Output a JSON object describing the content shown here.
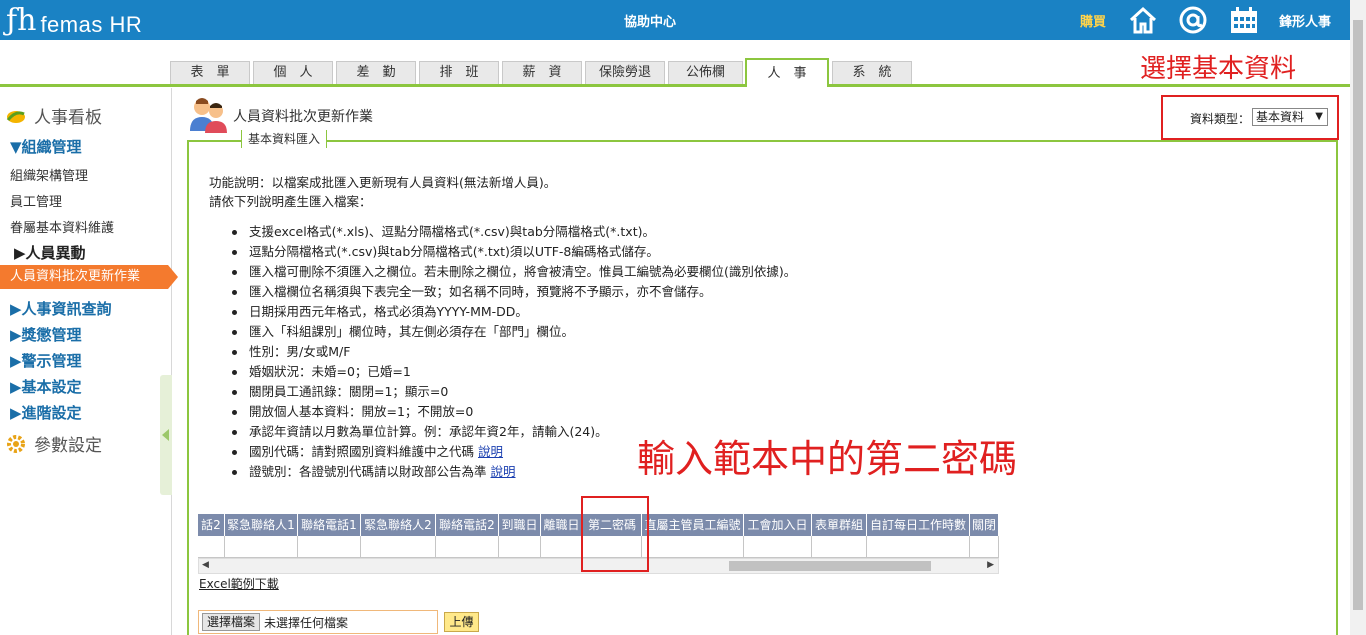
{
  "header": {
    "logo_text": "femas HR",
    "center_title": "協助中心",
    "buy_label": "購買",
    "home_icon": "home-icon",
    "at_icon": "at-icon",
    "calendar_icon": "calendar-icon",
    "user_name": "鋒形人事"
  },
  "tabs": [
    {
      "label": "表　單"
    },
    {
      "label": "個　人"
    },
    {
      "label": "差　勤"
    },
    {
      "label": "排　班"
    },
    {
      "label": "薪　資"
    },
    {
      "label": "保險勞退"
    },
    {
      "label": "公佈欄"
    },
    {
      "label": "人　事",
      "active": true
    },
    {
      "label": "系　統"
    }
  ],
  "annotations": {
    "top_right": "選擇基本資料",
    "middle": "輸入範本中的第二密碼"
  },
  "sidebar": {
    "head1": "人事看板",
    "group_org": "▼組織管理",
    "items_org": [
      "組織架構管理",
      "員工管理",
      "眷屬基本資料維護"
    ],
    "group_change": "▶人員異動",
    "active_item": "人員資料批次更新作業",
    "groups_more": [
      "▶人事資訊查詢",
      "▶獎懲管理",
      "▶警示管理",
      "▶基本設定",
      "▶進階設定"
    ],
    "head2": "參數設定"
  },
  "page": {
    "title": "人員資料批次更新作業",
    "legend": "基本資料匯入",
    "type_label": "資料類型：",
    "type_value": "基本資料",
    "desc1": "功能說明：以檔案成批匯入更新現有人員資料(無法新增人員)。",
    "desc2": "請依下列說明產生匯入檔案：",
    "bullets": [
      "支援excel格式(*.xls)、逗點分隔檔格式(*.csv)與tab分隔檔格式(*.txt)。",
      "逗點分隔檔格式(*.csv)與tab分隔檔格式(*.txt)須以UTF-8編碼格式儲存。",
      "匯入檔可刪除不須匯入之欄位。若未刪除之欄位，將會被清空。惟員工編號為必要欄位(識別依據)。",
      "匯入檔欄位名稱須與下表完全一致；如名稱不同時，預覽將不予顯示，亦不會儲存。",
      "日期採用西元年格式，格式必須為YYYY-MM-DD。",
      "匯入「科組課別」欄位時，其左側必須存在「部門」欄位。",
      "性別：男/女或M/F",
      "婚姻狀況：未婚=0；已婚=1",
      "關閉員工通訊錄：關閉=1；顯示=0",
      "開放個人基本資料：開放=1；不開放=0",
      "承認年資請以月數為單位計算。例：承認年資2年，請輸入(24)。"
    ],
    "bullet_country": "國別代碼：請對照國別資料維護中之代碼",
    "bullet_cert": "證號別：各證號別代碼請以財政部公告為準",
    "link_label": "說明",
    "table_headers": [
      "話2",
      "緊急聯絡人1",
      "聯絡電話1",
      "緊急聯絡人2",
      "聯絡電話2",
      "到職日",
      "離職日",
      "第二密碼",
      "直屬主管員工編號",
      "工會加入日",
      "表單群組",
      "自訂每日工作時數",
      "關閉"
    ],
    "excel_link": "Excel範例下載",
    "file_button": "選擇檔案",
    "file_status": "未選擇任何檔案",
    "upload_button": "上傳"
  },
  "colors": {
    "topbar": "#1a82c4",
    "accent_green": "#8cc63f",
    "active_orange": "#f47a2e",
    "annotation_red": "#e02020",
    "table_header": "#7c8bab"
  }
}
